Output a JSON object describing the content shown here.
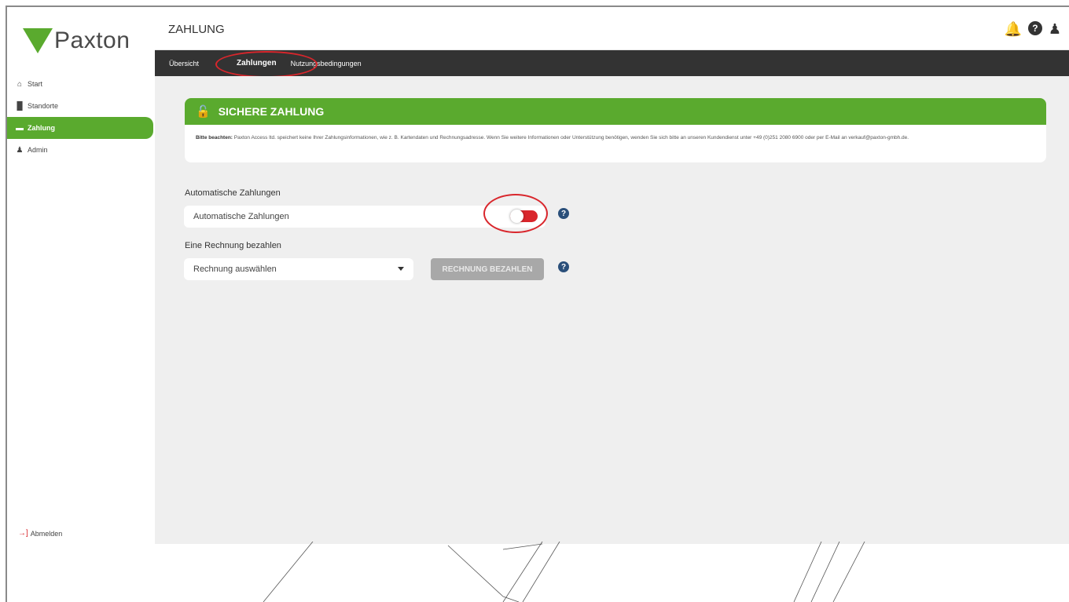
{
  "brand": {
    "name": "Paxton",
    "color": "#5aaa2e"
  },
  "header": {
    "title": "ZAHLUNG",
    "icons": [
      "bell-icon",
      "help-icon",
      "user-icon"
    ]
  },
  "sidebar": {
    "items": [
      {
        "label": "Start",
        "icon": "home-icon",
        "active": false
      },
      {
        "label": "Standorte",
        "icon": "building-icon",
        "active": false
      },
      {
        "label": "Zahlung",
        "icon": "card-icon",
        "active": true
      },
      {
        "label": "Admin",
        "icon": "user-icon",
        "active": false
      }
    ],
    "logout_label": "Abmelden"
  },
  "tabs": [
    {
      "label": "Übersicht",
      "active": false
    },
    {
      "label": "Zahlungen",
      "active": true
    },
    {
      "label": "Nutzungsbedingungen",
      "active": false
    }
  ],
  "notice": {
    "title": "SICHERE ZAHLUNG",
    "bold_prefix": "Bitte beachten:",
    "text": "Paxton Access ltd. speichert keine Ihrer Zahlungsinformationen, wie z. B. Kartendaten und Rechnungsadresse. Wenn Sie weitere Informationen oder Unterstützung benötigen, wenden Sie sich bitte an unseren Kundendienst unter +49 (0)251 2080 6900 oder per E-Mail an verkauf@paxton-gmbh.de."
  },
  "auto_payments": {
    "section_label": "Automatische Zahlungen",
    "field_label": "Automatische Zahlungen",
    "enabled": false
  },
  "invoice": {
    "section_label": "Eine Rechnung bezahlen",
    "select_value": "Rechnung auswählen",
    "pay_button": "RECHNUNG BEZAHLEN"
  }
}
